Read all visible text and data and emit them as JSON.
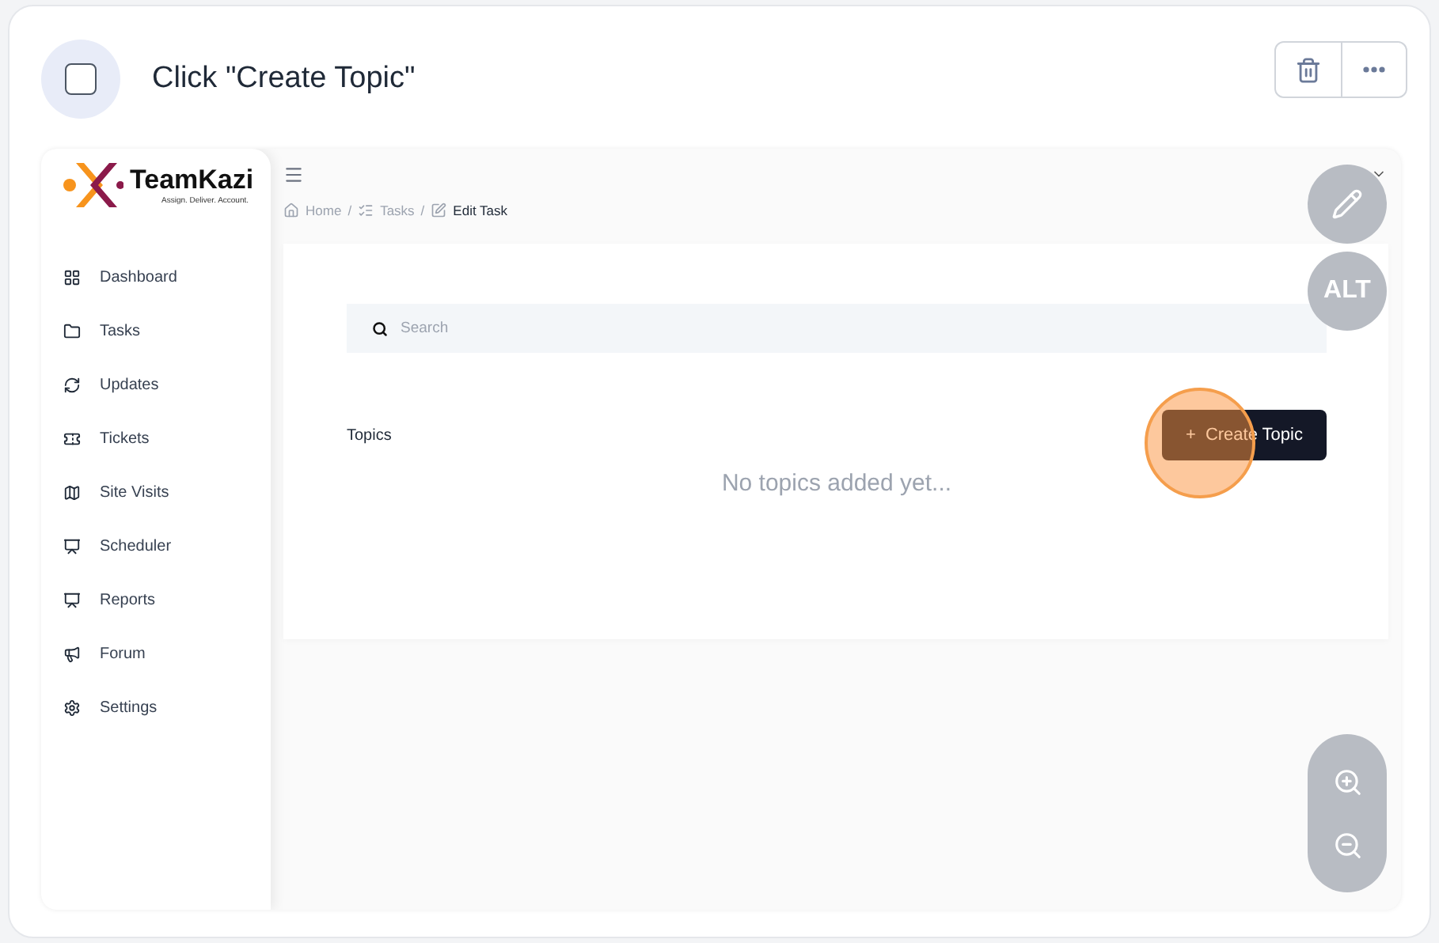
{
  "step": {
    "title": "Click \"Create Topic\"",
    "checked": false
  },
  "app": {
    "logo": {
      "name": "TeamKazi",
      "tagline": "Assign. Deliver. Account."
    },
    "sidebar": {
      "items": [
        {
          "label": "Dashboard"
        },
        {
          "label": "Tasks"
        },
        {
          "label": "Updates"
        },
        {
          "label": "Tickets"
        },
        {
          "label": "Site Visits"
        },
        {
          "label": "Scheduler"
        },
        {
          "label": "Reports"
        },
        {
          "label": "Forum"
        },
        {
          "label": "Settings"
        }
      ]
    },
    "breadcrumb": [
      {
        "label": "Home",
        "separator": "/"
      },
      {
        "label": "Tasks",
        "separator": "/"
      },
      {
        "label": "Edit Task"
      }
    ],
    "search": {
      "placeholder": "Search"
    },
    "topics": {
      "label": "Topics",
      "button": {
        "icon": "+",
        "label": "Create Topic"
      },
      "empty": "No topics added yet..."
    }
  },
  "overlay": {
    "alt": "ALT"
  }
}
